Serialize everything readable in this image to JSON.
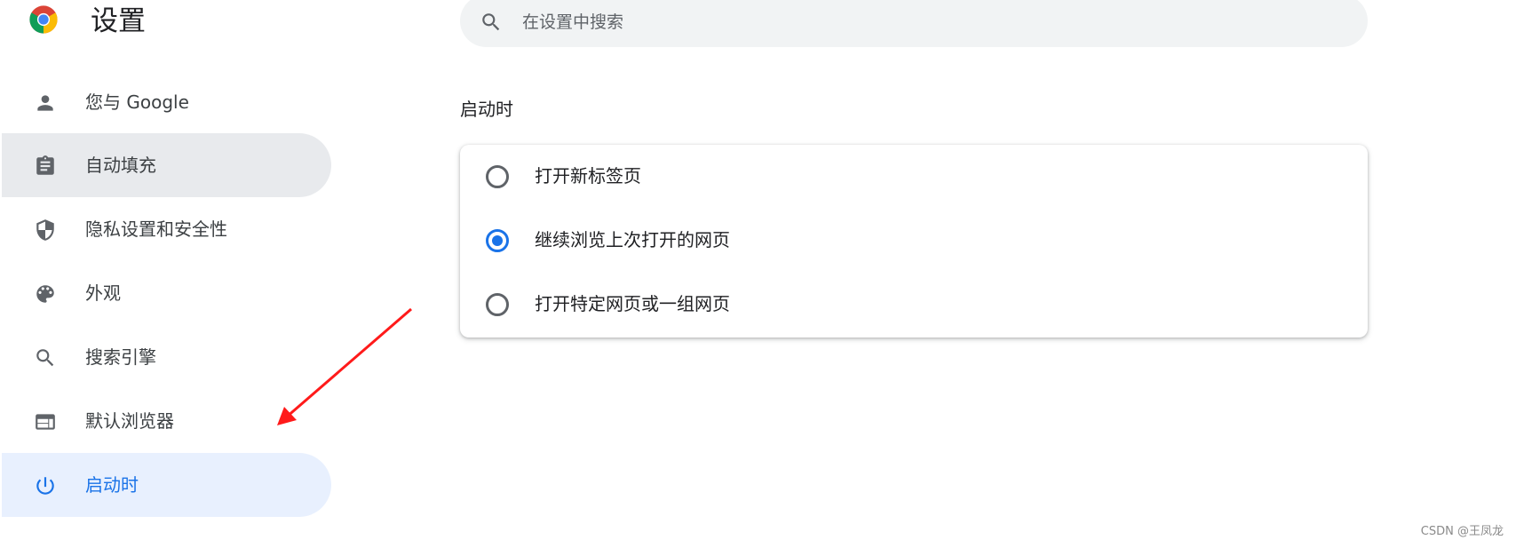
{
  "header": {
    "title": "设置",
    "logo_icon": "chrome-logo-icon"
  },
  "search": {
    "placeholder": "在设置中搜索",
    "value": "",
    "icon": "search-icon"
  },
  "sidebar": {
    "items": [
      {
        "label": "您与 Google",
        "icon": "person-icon",
        "state": "normal"
      },
      {
        "label": "自动填充",
        "icon": "clipboard-icon",
        "state": "hover"
      },
      {
        "label": "隐私设置和安全性",
        "icon": "shield-icon",
        "state": "normal"
      },
      {
        "label": "外观",
        "icon": "palette-icon",
        "state": "normal"
      },
      {
        "label": "搜索引擎",
        "icon": "search-icon",
        "state": "normal"
      },
      {
        "label": "默认浏览器",
        "icon": "browser-window-icon",
        "state": "normal"
      },
      {
        "label": "启动时",
        "icon": "power-icon",
        "state": "active"
      }
    ]
  },
  "main": {
    "section_title": "启动时",
    "options": [
      {
        "label": "打开新标签页",
        "checked": false
      },
      {
        "label": "继续浏览上次打开的网页",
        "checked": true
      },
      {
        "label": "打开特定网页或一组网页",
        "checked": false
      }
    ]
  },
  "annotation": {
    "arrow_color": "#ff1a1a"
  },
  "colors": {
    "accent": "#1a73e8",
    "active_bg": "#e8f0fe",
    "hover_bg": "#e8eaed",
    "search_bg": "#f1f3f4",
    "icon_gray": "#5f6368"
  },
  "watermark": "CSDN @王凤龙"
}
